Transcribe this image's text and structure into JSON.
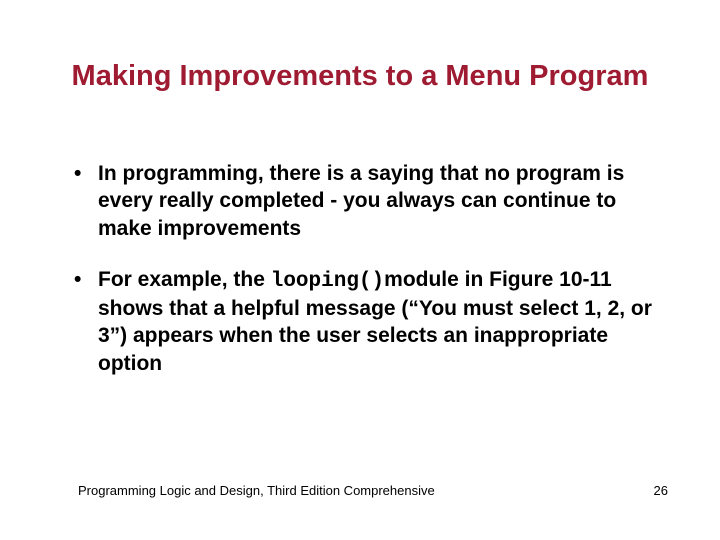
{
  "title": "Making Improvements to a Menu Program",
  "bullets": {
    "b1": "In programming, there is a saying that no program is every really completed - you always can continue to make improvements",
    "b2_pre": "For example, the ",
    "b2_code": "looping()",
    "b2_post": "module in Figure 10-11 shows that a helpful message (“You must select 1, 2, or 3”) appears when the user selects an inappropriate option"
  },
  "footer": {
    "left": "Programming Logic and Design, Third Edition Comprehensive",
    "page": "26"
  }
}
